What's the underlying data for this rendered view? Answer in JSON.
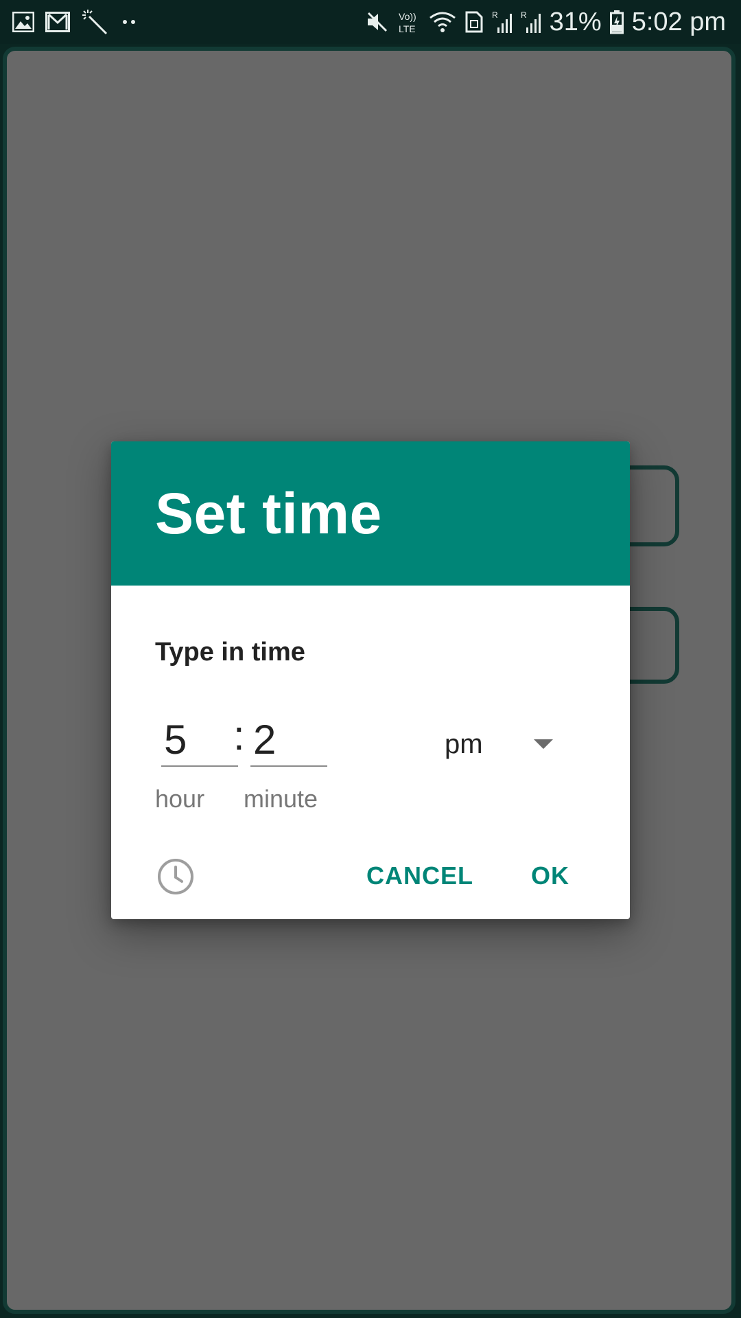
{
  "status_bar": {
    "left_icons": [
      "gallery-icon",
      "gmail-icon",
      "magic-wand-icon",
      "more-notifications-icon"
    ],
    "right_icons": [
      "mute-icon",
      "volte-icon",
      "wifi-icon",
      "sim-icon",
      "signal-r1-icon",
      "signal-r2-icon",
      "battery-charging-icon"
    ],
    "volte_label_top": "Vo))",
    "volte_label_bottom": "LTE",
    "battery_percent": "31%",
    "time": "5:02 pm"
  },
  "dialog": {
    "title": "Set time",
    "prompt": "Type in time",
    "hour": {
      "value": "5",
      "label": "hour"
    },
    "separator": ":",
    "minute": {
      "value": "2",
      "label": "minute"
    },
    "ampm": {
      "value": "pm"
    },
    "mode_toggle_icon": "clock-icon",
    "cancel_label": "CANCEL",
    "ok_label": "OK"
  },
  "colors": {
    "accent": "#008577",
    "status_bar": "#0a2320",
    "scrim": "#686868",
    "border": "#123a34"
  }
}
